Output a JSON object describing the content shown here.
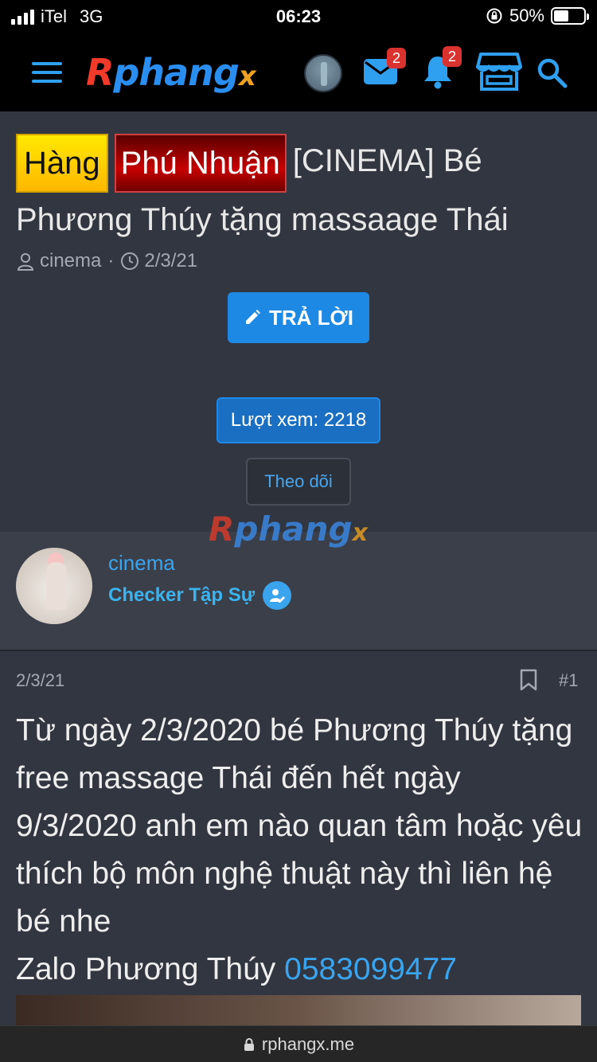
{
  "status_bar": {
    "carrier": "iTel",
    "network": "3G",
    "time": "06:23",
    "battery": "50%",
    "battery_level": 0.5
  },
  "header": {
    "logo": {
      "r": "R",
      "mid": "phang",
      "x": "x"
    },
    "messages_badge": "2",
    "alerts_badge": "2"
  },
  "thread": {
    "prefix_1": "Hàng",
    "prefix_2": "Phú Nhuận",
    "title": "[CINEMA] Bé Phương Thúy tặng massaage Thái",
    "author": "cinema",
    "date": "2/3/21",
    "reply_button": "TRẢ LỜI",
    "views": "Lượt xem: 2218",
    "follow_button": "Theo dõi"
  },
  "watermark": {
    "r": "R",
    "mid": "phang",
    "x": "x"
  },
  "user": {
    "name": "cinema",
    "role": "Checker Tập Sự"
  },
  "post": {
    "date": "2/3/21",
    "number": "#1",
    "body": "Từ ngày 2/3/2020 bé Phương Thúy tặng free massage Thái đến hết ngày 9/3/2020 anh em nào quan tâm hoặc yêu thích bộ môn nghệ thuật này thì liên hệ bé nhe",
    "zalo_label": "Zalo Phương Thúy ",
    "phone": "0583099477"
  },
  "url_bar": {
    "domain": "rphangx.me"
  },
  "colors": {
    "accent": "#1e88e5",
    "link": "#3aa4ee",
    "background": "#323640",
    "header": "#000000"
  }
}
